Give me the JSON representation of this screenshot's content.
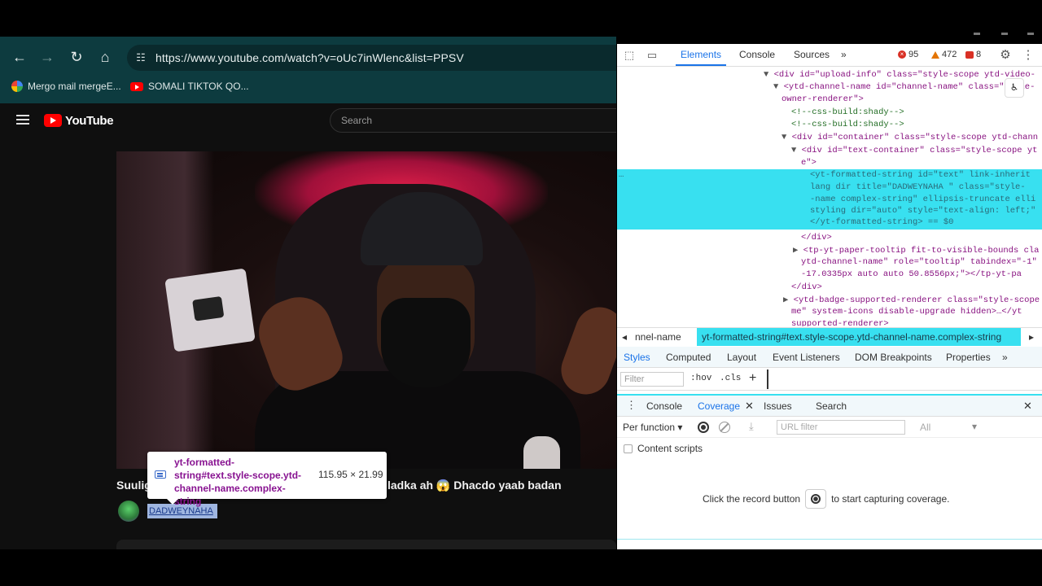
{
  "browser": {
    "url": "https://www.youtube.com/watch?v=oUc7inWlenc&list=PPSV",
    "bookmarks": [
      {
        "label": "Mergo mail mergeE...",
        "icon": "mergo-icon"
      },
      {
        "label": "SOMALI TIKTOK QO...",
        "icon": "youtube-icon"
      }
    ],
    "colors": {
      "chrome": "#0d3b3f",
      "page": "#0f0f0f"
    }
  },
  "youtube": {
    "logo_text": "YouTube",
    "search_placeholder": "Search",
    "title_prefix": "Suulig",
    "title_suffix": "ladka ah 😱 Dhacdo yaab badan",
    "channel_name": "DADWEYNAHA"
  },
  "inspect_tooltip": {
    "selector": "yt-formatted-string#text.style-scope.ytd-channel-name.complex-string",
    "size": "115.95 × 21.99"
  },
  "devtools": {
    "tabs": [
      "Elements",
      "Console",
      "Sources"
    ],
    "active_tab": "Elements",
    "more_tabs": "»",
    "errors": "95",
    "warnings": "472",
    "issues": "8",
    "dom_lines": [
      {
        "l1": "<div id=\"upload-info\" class=\"style-scope ytd-video-"
      },
      {
        "l2": "<ytd-channel-name id=\"channel-name\" class=\"style-"
      },
      {
        "l3": "owner-renderer\">"
      },
      {
        "l4": "<!--css-build:shady-->"
      },
      {
        "l5": "<!--css-build:shady-->"
      },
      {
        "l6": "<div id=\"container\" class=\"style-scope ytd-chann"
      },
      {
        "l7": "<div id=\"text-container\" class=\"style-scope yt"
      },
      {
        "l8": "e\">"
      }
    ],
    "highlighted_lines": [
      "<yt-formatted-string id=\"text\" link-inherit",
      "lang dir title=\"DADWEYNAHA \" class=\"style-",
      "-name complex-string\" ellipsis-truncate elli",
      "styling dir=\"auto\" style=\"text-align: left;\"",
      "</yt-formatted-string> == $0"
    ],
    "after_lines": [
      "</div>",
      "<tp-yt-paper-tooltip fit-to-visible-bounds cla",
      "ytd-channel-name\" role=\"tooltip\" tabindex=\"-1\"",
      "-17.0335px auto auto 50.8556px;\"></tp-yt-pa",
      "</div>",
      "<ytd-badge-supported-renderer class=\"style-scope",
      "me\" system-icons disable-upgrade hidden>…</yt",
      "supported-renderer>"
    ],
    "breadcrumb_prev": "nnel-name",
    "breadcrumb_selected": "yt-formatted-string#text.style-scope.ytd-channel-name.complex-string",
    "sub_tabs": [
      "Styles",
      "Computed",
      "Layout",
      "Event Listeners",
      "DOM Breakpoints",
      "Properties"
    ],
    "active_sub_tab": "Styles",
    "filter_placeholder": "Filter",
    "hov": ":hov",
    "cls": ".cls",
    "drawer_tabs": [
      "Console",
      "Coverage",
      "Issues",
      "Search"
    ],
    "active_drawer_tab": "Coverage",
    "per_function": "Per function",
    "url_filter_placeholder": "URL filter",
    "all_option": "All",
    "content_scripts": "Content scripts",
    "empty_prefix": "Click the record button",
    "empty_suffix": "to start capturing coverage."
  }
}
